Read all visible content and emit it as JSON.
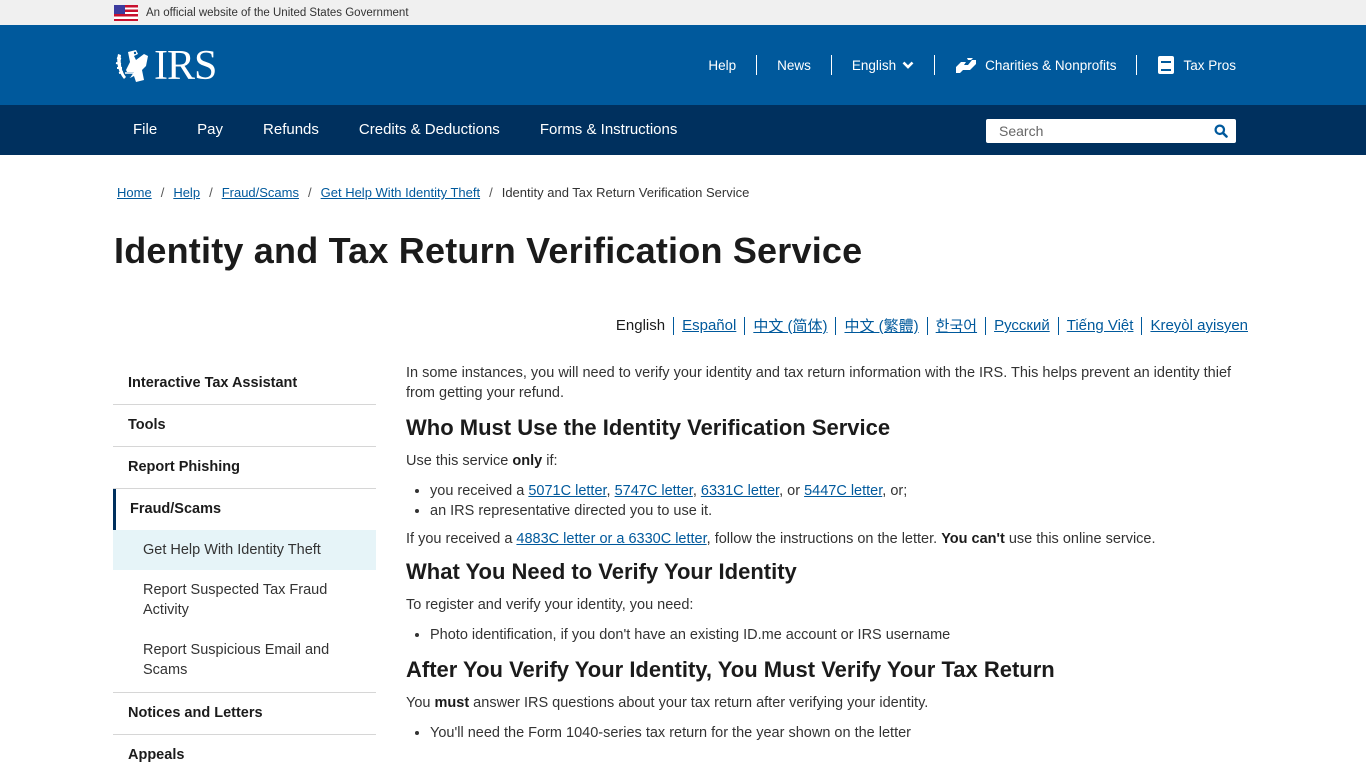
{
  "gov_banner": {
    "text": "An official website of the United States Government"
  },
  "header": {
    "logo_text": "IRS",
    "utility_nav": {
      "help": "Help",
      "news": "News",
      "language": "English",
      "charities": "Charities & Nonprofits",
      "tax_pros": "Tax Pros"
    }
  },
  "main_nav": {
    "items": [
      "File",
      "Pay",
      "Refunds",
      "Credits & Deductions",
      "Forms & Instructions"
    ],
    "search_placeholder": "Search"
  },
  "breadcrumb": {
    "items": [
      "Home",
      "Help",
      "Fraud/Scams",
      "Get Help With Identity Theft"
    ],
    "current": "Identity and Tax Return Verification Service"
  },
  "page_title": "Identity and Tax Return Verification Service",
  "languages": {
    "active": "English",
    "links": [
      "Español",
      "中文 (简体)",
      "中文 (繁體)",
      "한국어",
      "Русский",
      "Tiếng Việt",
      "Kreyòl ayisyen"
    ]
  },
  "sidebar": {
    "items": [
      "Interactive Tax Assistant",
      "Tools",
      "Report Phishing"
    ],
    "active_section": "Fraud/Scams",
    "subitems": [
      "Get Help With Identity Theft",
      "Report Suspected Tax Fraud Activity",
      "Report Suspicious Email and Scams"
    ],
    "items_after": [
      "Notices and Letters",
      "Appeals"
    ]
  },
  "content": {
    "intro": "In some instances, you will need to verify your identity and tax return information with the IRS. This helps prevent an identity thief from getting your refund.",
    "section1": {
      "heading": "Who Must Use the Identity Verification Service",
      "lead_pre": "Use this service ",
      "lead_bold": "only",
      "lead_post": " if:",
      "bullet1_pre": "you received a ",
      "letter_links": [
        "5071C letter",
        "5747C letter",
        "6331C letter",
        "5447C letter"
      ],
      "sep_comma": ", ",
      "sep_or": ", or ",
      "bullet1_post": ", or;",
      "bullet2": "an IRS representative directed you to use it.",
      "note_pre": "If you received a ",
      "note_link": "4883C letter or a 6330C letter",
      "note_mid": ", follow the instructions on the letter. ",
      "note_bold": "You can't",
      "note_post": " use this online service."
    },
    "section2": {
      "heading": "What You Need to Verify Your Identity",
      "lead": "To register and verify your identity, you need:",
      "bullet1": "Photo identification, if you don't have an existing ID.me account or IRS username"
    },
    "section3": {
      "heading": "After You Verify Your Identity, You Must Verify Your Tax Return",
      "lead_pre": "You ",
      "lead_bold": "must",
      "lead_post": " answer IRS questions about your tax return after verifying your identity.",
      "bullet1": "You'll need the Form 1040-series tax return for the year shown on the letter"
    }
  },
  "colors": {
    "header_blue": "#00599c",
    "nav_navy": "#00305e",
    "link": "#00599c",
    "sidebar_highlight": "#e6f4f8"
  }
}
